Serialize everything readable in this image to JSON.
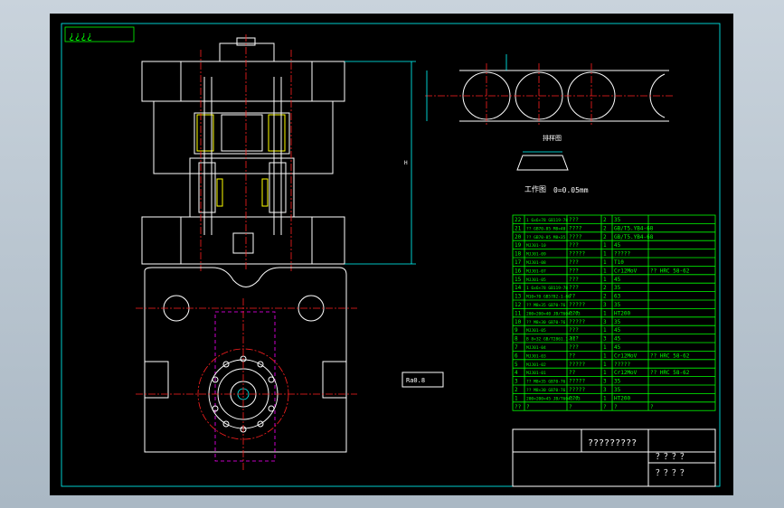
{
  "title_block": {
    "corner_marks": "¿¿¿¿",
    "drawing_title": "?????????",
    "sign_marks": [
      "？？？？",
      "？？？？"
    ]
  },
  "part_view": {
    "label": "排样图",
    "strip_label": "工作图",
    "tolerance": "0=0.05mm"
  },
  "section_label": "Ra0.8",
  "colors": {
    "background": "#000000",
    "border": "#00ffff",
    "outline": "#ffffff",
    "center": "#ff2020",
    "hidden": "#ff00ff",
    "table": "#00ff00",
    "hatch": "#ffff00"
  },
  "bom": {
    "header": [
      "??",
      "?",
      "?",
      "?",
      "?",
      "?"
    ],
    "rows": [
      {
        "no": "22",
        "name": "1 6x6×78 GB119-78",
        "qty_name": "???",
        "qty": "2",
        "mat": "35",
        "note": ""
      },
      {
        "no": "21",
        "name": "?? GB70-85 M8×40",
        "qty_name": "????",
        "qty": "2",
        "mat": "GB/T5.YB4-68",
        "note": ""
      },
      {
        "no": "20",
        "name": "?? GB70-85 M8×35",
        "qty_name": "????",
        "qty": "2",
        "mat": "GB/T5.YB4-68",
        "note": ""
      },
      {
        "no": "19",
        "name": "MJJ01-10",
        "qty_name": "???",
        "qty": "1",
        "mat": "45",
        "note": ""
      },
      {
        "no": "18",
        "name": "MJJ01-09",
        "qty_name": "?????",
        "qty": "1",
        "mat": "?????",
        "note": ""
      },
      {
        "no": "17",
        "name": "MJJ01-08",
        "qty_name": "???",
        "qty": "1",
        "mat": "T10",
        "note": ""
      },
      {
        "no": "16",
        "name": "MJJ01-07",
        "qty_name": "???",
        "qty": "1",
        "mat": "Cr12MoV",
        "note": "?? HRC 58-62"
      },
      {
        "no": "15",
        "name": "MJJ01-05",
        "qty_name": "???",
        "qty": "1",
        "mat": "45",
        "note": ""
      },
      {
        "no": "14",
        "name": "1 6x6×78 GB119-78",
        "qty_name": "???",
        "qty": "2",
        "mat": "35",
        "note": ""
      },
      {
        "no": "13",
        "name": "M10×70 GB5782-1-86",
        "qty_name": "??",
        "qty": "2",
        "mat": "63",
        "note": ""
      },
      {
        "no": "12",
        "name": "?? M8×35 GB70-76",
        "qty_name": "?????",
        "qty": "3",
        "mat": "35",
        "note": ""
      },
      {
        "no": "11",
        "name": "200×200×40 JB/T6041-93",
        "qty_name": "???",
        "qty": "1",
        "mat": "HT200",
        "note": ""
      },
      {
        "no": "10",
        "name": "?? M8×30 GB70-76",
        "qty_name": "?????",
        "qty": "3",
        "mat": "35",
        "note": ""
      },
      {
        "no": "9",
        "name": "MJJ01-05",
        "qty_name": "???",
        "qty": "1",
        "mat": "45",
        "note": ""
      },
      {
        "no": "8",
        "name": "B 8×32 GB/T2861.1-81",
        "qty_name": "???",
        "qty": "3",
        "mat": "45",
        "note": ""
      },
      {
        "no": "7",
        "name": "MJJ01-04",
        "qty_name": "???",
        "qty": "1",
        "mat": "45",
        "note": ""
      },
      {
        "no": "6",
        "name": "MJJ01-03",
        "qty_name": "??",
        "qty": "1",
        "mat": "Cr12MoV",
        "note": "?? HRC 58-62"
      },
      {
        "no": "5",
        "name": "MJJ01-02",
        "qty_name": "?????",
        "qty": "1",
        "mat": "?????",
        "note": ""
      },
      {
        "no": "4",
        "name": "MJJ01-01",
        "qty_name": "??",
        "qty": "1",
        "mat": "Cr12MoV",
        "note": "?? HRC 58-62"
      },
      {
        "no": "3",
        "name": "?? M8×35 GB70-76",
        "qty_name": "?????",
        "qty": "3",
        "mat": "35",
        "note": ""
      },
      {
        "no": "2",
        "name": "?? M8×30 GB70-76",
        "qty_name": "?????",
        "qty": "3",
        "mat": "35",
        "note": ""
      },
      {
        "no": "1",
        "name": "200×200×45 JB/T6041-93",
        "qty_name": "???",
        "qty": "1",
        "mat": "HT200",
        "note": ""
      }
    ]
  }
}
